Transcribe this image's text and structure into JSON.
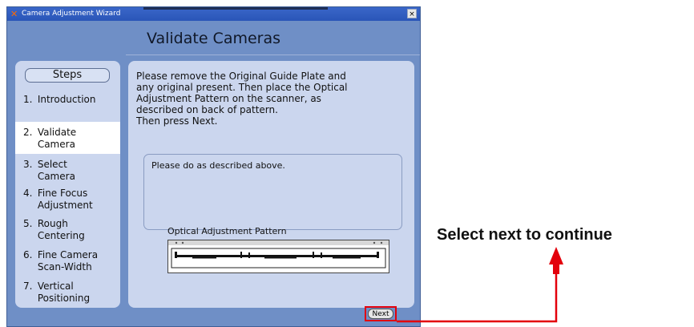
{
  "window": {
    "title": "Camera Adjustment Wizard",
    "close_label": "×",
    "app_icon": "x-logo-icon"
  },
  "page_title": "Validate Cameras",
  "steps": {
    "header": "Steps",
    "items": [
      {
        "num": "1.",
        "label": "Introduction",
        "active": false
      },
      {
        "num": "2.",
        "label": "Validate Camera",
        "active": true
      },
      {
        "num": "3.",
        "label": "Select Camera",
        "active": false
      },
      {
        "num": "4.",
        "label": "Fine Focus Adjustment",
        "active": false
      },
      {
        "num": "5.",
        "label": "Rough Centering",
        "active": false
      },
      {
        "num": "6.",
        "label": "Fine Camera Scan-Width",
        "active": false
      },
      {
        "num": "7.",
        "label": "Vertical Positioning",
        "active": false
      }
    ]
  },
  "content": {
    "instructions": "Please remove the Original Guide Plate and\nany original present. Then place the Optical\nAdjustment Pattern on the scanner, as\ndescribed on back of pattern.\nThen press Next.",
    "status_text": "Please do as described above.",
    "pattern_label": "Optical Adjustment Pattern"
  },
  "footer": {
    "next_label": "Next"
  },
  "annotation": {
    "text": "Select next to continue",
    "color": "#e3000b"
  }
}
